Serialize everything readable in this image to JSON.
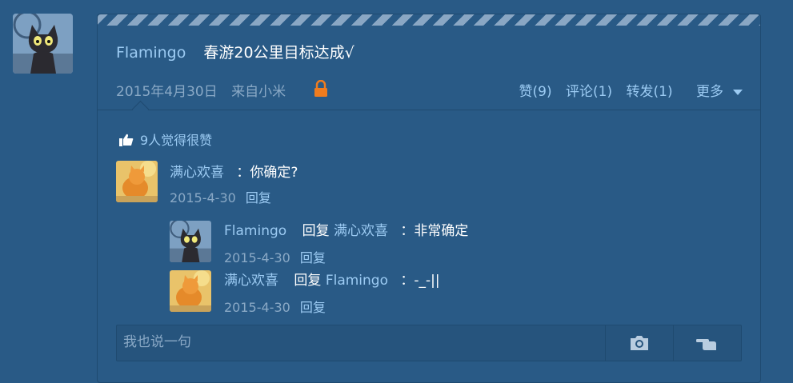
{
  "post": {
    "author": "Flamingo",
    "text": "春游20公里目标达成√",
    "date": "2015年4月30日",
    "source": "来自小米"
  },
  "actions": {
    "like": "赞(9)",
    "comment": "评论(1)",
    "forward": "转发(1)",
    "more": "更多"
  },
  "likes_summary": "9人觉得很赞",
  "comments": [
    {
      "author": "满心欢喜",
      "text": "：你确定?",
      "date": "2015-4-30",
      "reply": "回复"
    }
  ],
  "replies": [
    {
      "author": "Flamingo",
      "reply_word": "回复",
      "target": "满心欢喜",
      "text": "：非常确定",
      "date": "2015-4-30",
      "reply": "回复"
    },
    {
      "author": "满心欢喜",
      "reply_word": "回复",
      "target": "Flamingo",
      "text": "：-_-||",
      "date": "2015-4-30",
      "reply": "回复"
    }
  ],
  "input": {
    "placeholder": "我也说一句"
  },
  "colors": {
    "background": "#295a86",
    "link": "#9ccbf3",
    "muted": "#8aa9c6",
    "lock": "#f07c1e"
  },
  "icons": [
    "cat-avatar",
    "lock-icon",
    "thumbs-up-icon",
    "camera-icon",
    "pointing-hand-icon",
    "caret-down-icon"
  ]
}
